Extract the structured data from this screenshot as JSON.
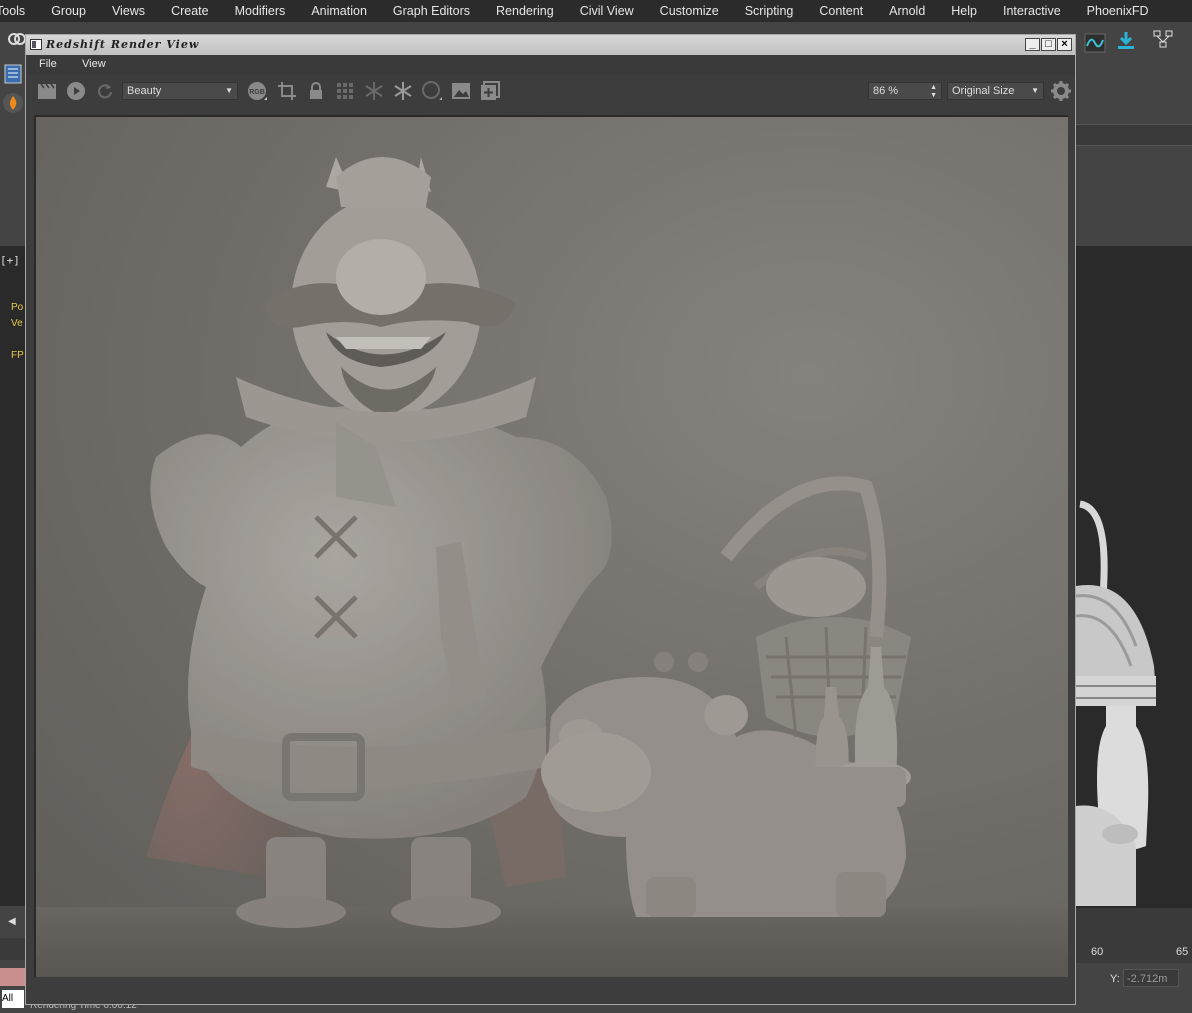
{
  "menubar": {
    "items": [
      "Tools",
      "Group",
      "Views",
      "Create",
      "Modifiers",
      "Animation",
      "Graph Editors",
      "Rendering",
      "Civil View",
      "Customize",
      "Scripting",
      "Content",
      "Arnold",
      "Help",
      "Interactive",
      "PhoenixFD"
    ]
  },
  "viewport_left": {
    "label": "[+]",
    "stats": [
      "Po",
      "Ve",
      "FP"
    ]
  },
  "timeline": {
    "ticks": [
      "60",
      "65"
    ]
  },
  "coords": {
    "y_label": "Y:",
    "y_value": "-2.712m"
  },
  "left_bottom": {
    "all_label": "All"
  },
  "status": {
    "text": "Rendering Time 0:00:12"
  },
  "render_window": {
    "title": "Redshift Render View",
    "menu": [
      "File",
      "View"
    ],
    "aov_select": "Beauty",
    "zoom_select": "86 %",
    "size_select": "Original Size"
  },
  "colors": {
    "app_bg": "#444444",
    "menubar_bg": "#2b2b2b",
    "viewport_bg": "#2a2a2a",
    "accent_cyan": "#2ab3d6",
    "stat_yellow": "#e8c84a"
  }
}
